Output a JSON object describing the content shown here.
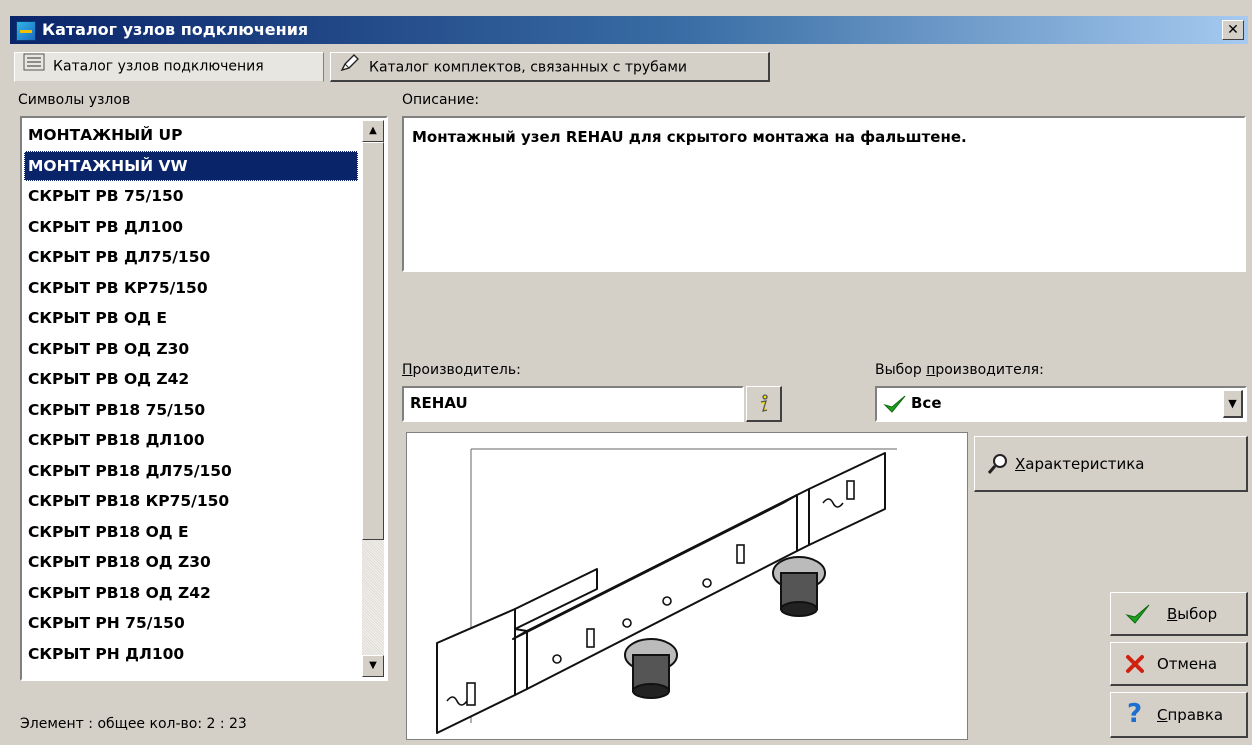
{
  "window": {
    "title": "Каталог узлов подключения",
    "close_glyph": "✕"
  },
  "tabs": [
    {
      "label": "Каталог узлов подключения",
      "icon": "list-icon",
      "active": true
    },
    {
      "label": "Каталог комплектов, связанных с трубами",
      "icon": "pencil-icon",
      "active": false
    }
  ],
  "symbols": {
    "label": "Символы узлов",
    "items": [
      "МОНТАЖНЫЙ UP",
      "МОНТАЖНЫЙ VW",
      "СКРЫТ РВ 75/150",
      "СКРЫТ РВ ДЛ100",
      "СКРЫТ РВ ДЛ75/150",
      "СКРЫТ РВ КР75/150",
      "СКРЫТ РВ ОД Е",
      "СКРЫТ РВ ОД Z30",
      "СКРЫТ РВ ОД Z42",
      "СКРЫТ РВ18 75/150",
      "СКРЫТ РВ18 ДЛ100",
      "СКРЫТ РВ18 ДЛ75/150",
      "СКРЫТ РВ18 КР75/150",
      "СКРЫТ РВ18 ОД Е",
      "СКРЫТ РВ18 ОД Z30",
      "СКРЫТ РВ18 ОД Z42",
      "СКРЫТ РН 75/150",
      "СКРЫТ РН ДЛ100"
    ],
    "selected_index": 1
  },
  "description": {
    "label": "Описание:",
    "text": "Монтажный узел REHAU для скрытого монтажа на фальштене."
  },
  "manufacturer": {
    "label_prefix": "П",
    "label_rest": "роизводитель:",
    "value": "REHAU"
  },
  "manufacturer_choice": {
    "label_prefix": "Выбор ",
    "label_u": "п",
    "label_rest": "роизводителя:",
    "value": "Все"
  },
  "buttons": {
    "characteristics": {
      "u": "Х",
      "rest": "арактеристика"
    },
    "select": {
      "u": "В",
      "rest": "ыбор"
    },
    "cancel": {
      "label": "Отмена"
    },
    "help": {
      "u": "С",
      "rest": "правка"
    }
  },
  "status": {
    "text": "Элемент : общее кол-во: 2 : 23"
  },
  "colors": {
    "selection": "#0a246a",
    "check": "#1fa01f",
    "cancel": "#d02010",
    "help": "#1a6fd0"
  }
}
